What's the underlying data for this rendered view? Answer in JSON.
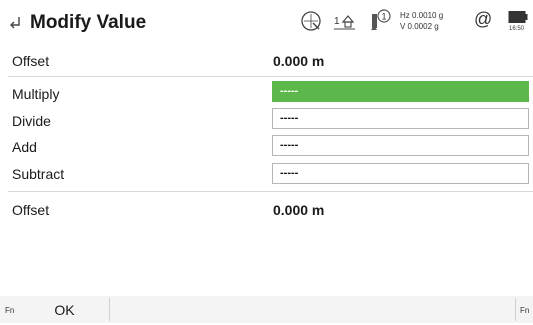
{
  "header": {
    "title": "Modify Value",
    "hz": "Hz 0.0010 g",
    "v": "V  0.0002 g",
    "station_label": "1",
    "tilt_label": "1",
    "at_symbol": "@",
    "time": "16:50"
  },
  "rows": {
    "offset_top": {
      "label": "Offset",
      "value": "0.000 m"
    },
    "multiply": {
      "label": "Multiply",
      "value": "-----"
    },
    "divide": {
      "label": "Divide",
      "value": "-----"
    },
    "add": {
      "label": "Add",
      "value": "-----"
    },
    "subtract": {
      "label": "Subtract",
      "value": "-----"
    },
    "offset_bottom": {
      "label": "Offset",
      "value": "0.000 m"
    }
  },
  "footer": {
    "fn_left": "Fn",
    "ok_label": "OK",
    "fn_right": "Fn"
  },
  "colors": {
    "active_field": "#5cb84a"
  }
}
